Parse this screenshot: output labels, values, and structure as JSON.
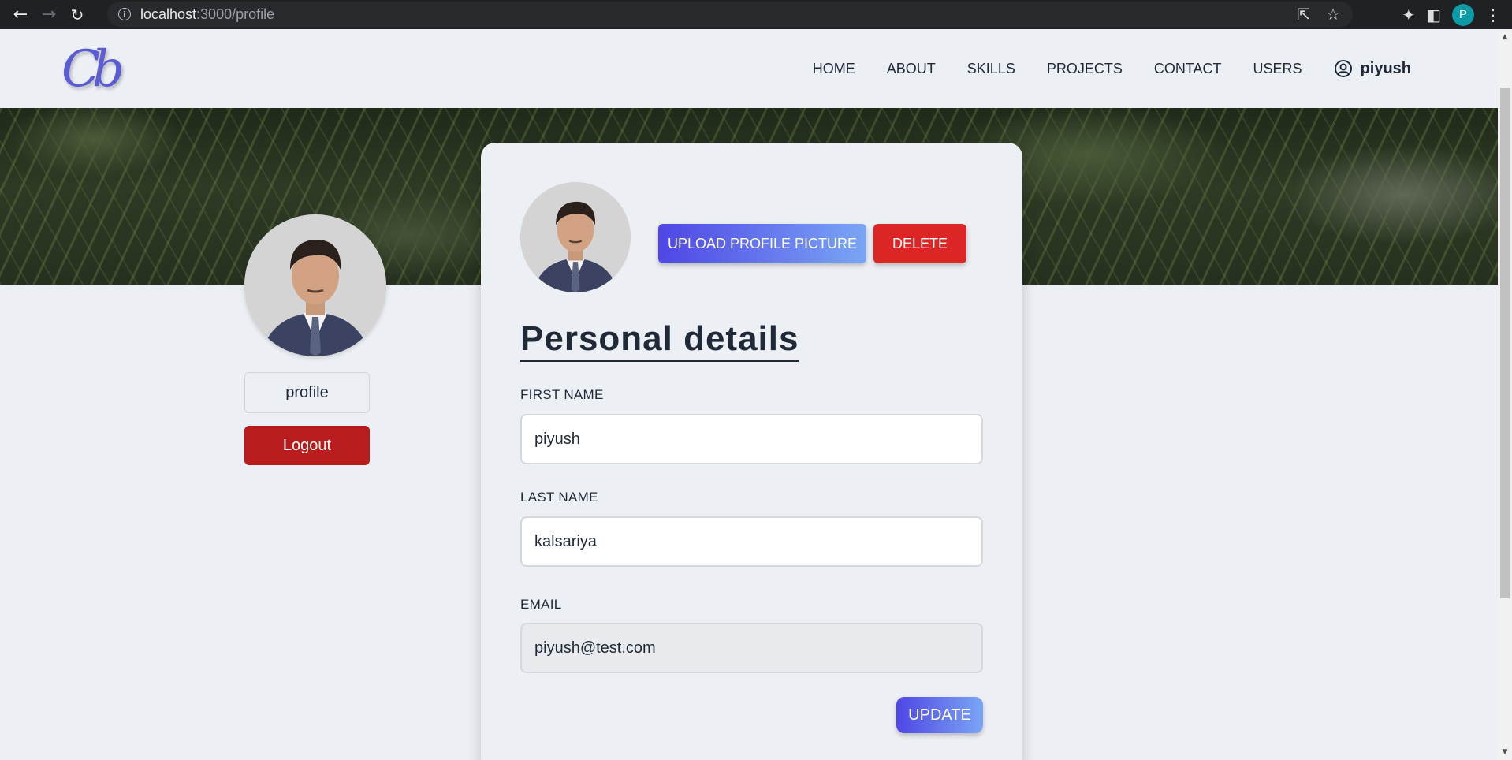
{
  "browser": {
    "back_icon": "arrow-left-icon",
    "forward_icon": "arrow-right-icon",
    "reload_icon": "reload-icon",
    "url_host": "localhost",
    "url_path": ":3000/profile",
    "profile_initial": "P"
  },
  "header": {
    "logo_text": "Cb",
    "nav": [
      "HOME",
      "ABOUT",
      "SKILLS",
      "PROJECTS",
      "CONTACT",
      "USERS"
    ],
    "user_name": "piyush"
  },
  "sidebar": {
    "profile_label": "profile",
    "logout_label": "Logout"
  },
  "card": {
    "upload_label": "UPLOAD PROFILE PICTURE",
    "delete_label": "DELETE",
    "title": "Personal details",
    "fields": {
      "first_name": {
        "label": "FIRST NAME",
        "value": "piyush"
      },
      "last_name": {
        "label": "LAST NAME",
        "value": "kalsariya"
      },
      "email": {
        "label": "EMAIL",
        "value": "piyush@test.com"
      }
    },
    "update_label": "UPDATE"
  },
  "colors": {
    "accent_start": "#4f46e5",
    "accent_end": "#7aa6f5",
    "danger": "#dc2626",
    "logout": "#b91c1c",
    "background": "#eceff3"
  }
}
